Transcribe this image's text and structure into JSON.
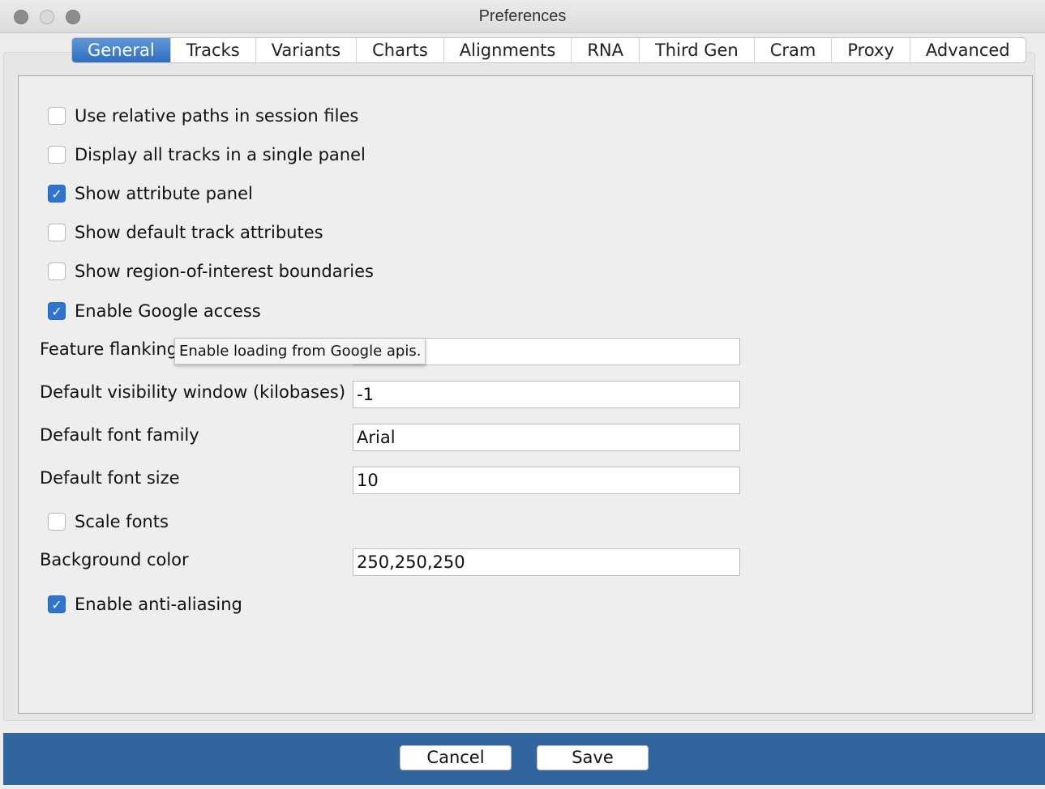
{
  "window": {
    "title": "Preferences"
  },
  "tabs": [
    {
      "label": "General",
      "active": true
    },
    {
      "label": "Tracks",
      "active": false
    },
    {
      "label": "Variants",
      "active": false
    },
    {
      "label": "Charts",
      "active": false
    },
    {
      "label": "Alignments",
      "active": false
    },
    {
      "label": "RNA",
      "active": false
    },
    {
      "label": "Third Gen",
      "active": false
    },
    {
      "label": "Cram",
      "active": false
    },
    {
      "label": "Proxy",
      "active": false
    },
    {
      "label": "Advanced",
      "active": false
    }
  ],
  "general": {
    "use_relative_paths": {
      "label": "Use relative paths in session files",
      "checked": false
    },
    "display_single_panel": {
      "label": "Display all tracks in a single panel",
      "checked": false
    },
    "show_attribute_panel": {
      "label": "Show attribute panel",
      "checked": true
    },
    "show_default_track_attributes": {
      "label": "Show default track attributes",
      "checked": false
    },
    "show_roi_boundaries": {
      "label": "Show region-of-interest boundaries",
      "checked": false
    },
    "enable_google_access": {
      "label": "Enable Google access",
      "checked": true
    },
    "feature_flanking": {
      "label": "Feature flanking",
      "value": ""
    },
    "visibility_window": {
      "label": "Default visibility window (kilobases)",
      "value": "-1"
    },
    "font_family": {
      "label": "Default font family",
      "value": "Arial"
    },
    "font_size": {
      "label": "Default font size",
      "value": "10"
    },
    "scale_fonts": {
      "label": "Scale fonts",
      "checked": false
    },
    "background_color": {
      "label": "Background color",
      "value": "250,250,250"
    },
    "anti_aliasing": {
      "label": "Enable anti-aliasing",
      "checked": true
    }
  },
  "tooltip": {
    "text": "Enable loading from Google apis."
  },
  "footer": {
    "cancel_label": "Cancel",
    "save_label": "Save"
  },
  "colors": {
    "accent": "#2f74d0",
    "footer": "#32659e",
    "active_tab": "#3d7fcd"
  },
  "icons": {
    "check": "checkmark-icon"
  }
}
